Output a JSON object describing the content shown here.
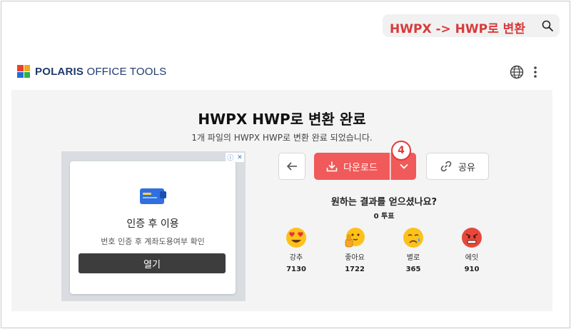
{
  "caption": {
    "text": "HWPX -> HWP로 변환",
    "color": "#d93a3a"
  },
  "header": {
    "brand": "POLARIS",
    "brand_rest": "OFFICE TOOLS",
    "brand_color": "#1e3a6e"
  },
  "main": {
    "title": "HWPX HWP로 변환 완료",
    "subtitle": "1개 파일의 HWPX HWP로 변환 완료 되었습니다.",
    "download_label": "다운로드",
    "share_label": "공유",
    "step_badge": "4",
    "question": "원하는 결과를 얻으셨나요?",
    "votes": "0 투표",
    "accent": "#f05a5a"
  },
  "ad": {
    "title": "인증 후 이용",
    "description": "번호 인증 후 계좌도용여부 확인",
    "button": "열기"
  },
  "reactions": [
    {
      "label": "강추",
      "count": "7130",
      "icon": "heart-eyes-emoji"
    },
    {
      "label": "좋아요",
      "count": "1722",
      "icon": "thumbs-up-emoji"
    },
    {
      "label": "별로",
      "count": "365",
      "icon": "sad-emoji"
    },
    {
      "label": "에잇",
      "count": "910",
      "icon": "angry-emoji"
    }
  ]
}
